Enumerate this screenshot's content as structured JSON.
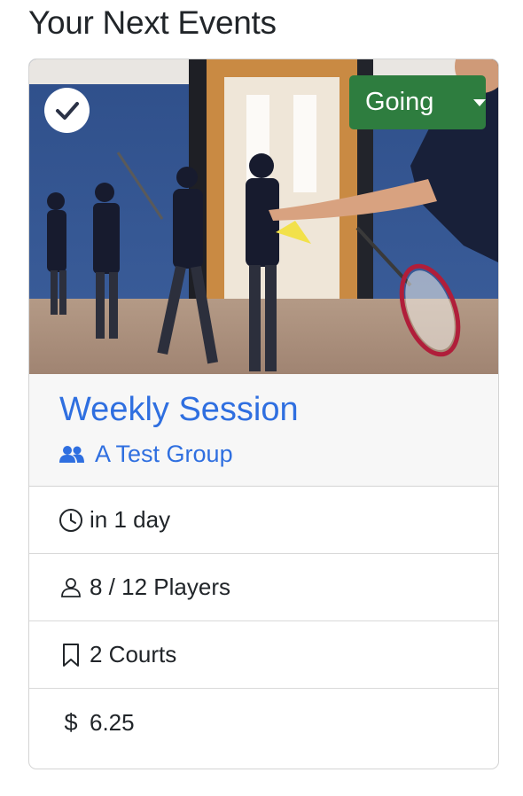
{
  "page": {
    "heading": "Your Next Events"
  },
  "event": {
    "status_label": "Going",
    "name": "Weekly Session",
    "group_name": "A Test Group",
    "details": {
      "time": "in 1 day",
      "players": "8 / 12 Players",
      "courts": "2 Courts",
      "currency_symbol": "$",
      "price": "6.25"
    }
  },
  "icons": {
    "check": "check-icon",
    "caret": "caret-down-icon",
    "group": "users-icon",
    "time": "clock-icon",
    "players": "person-icon",
    "courts": "bookmark-icon",
    "price": "dollar-icon"
  },
  "colors": {
    "accent_blue": "#2f6fe0",
    "going_green": "#2e7d3f",
    "header_bg": "#f7f7f7",
    "text": "#212529"
  }
}
